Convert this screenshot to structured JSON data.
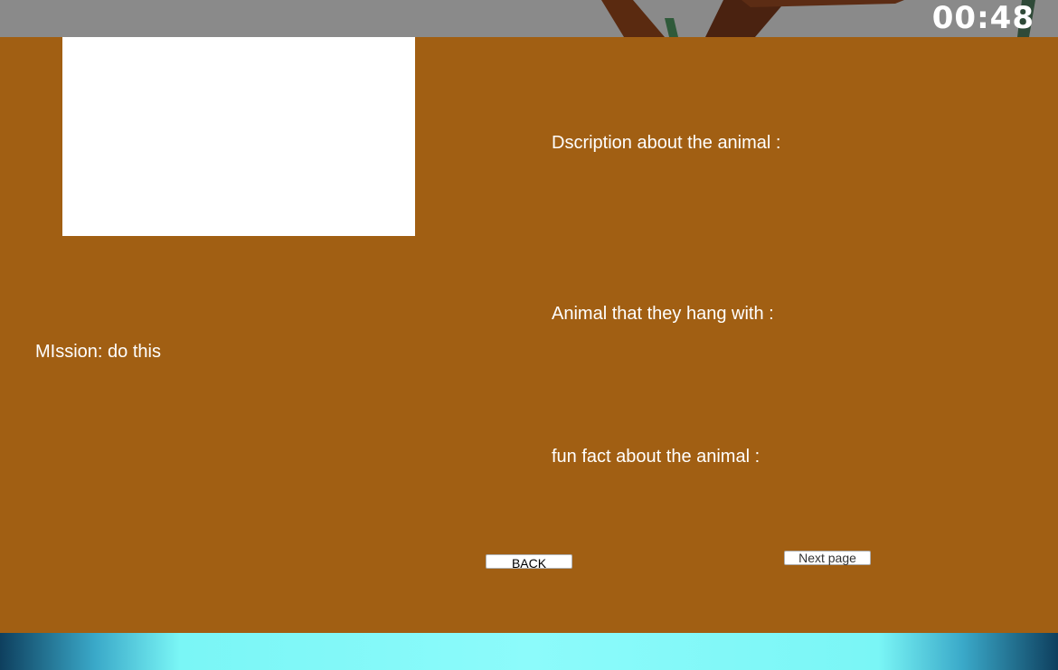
{
  "hud": {
    "timer": "00:48"
  },
  "info_panel": {
    "mission_text": "MIssion: do this",
    "description_label": "Dscription about the animal :",
    "companions_label": "Animal that they hang with :",
    "fun_fact_label": "fun fact about the animal :",
    "back_button_label": "BACK",
    "next_button_label": "Next page"
  },
  "colors": {
    "panel_background": "#a15f13",
    "top_bar": "#8a8a8a",
    "sky_strip": "#8cfbfb"
  }
}
